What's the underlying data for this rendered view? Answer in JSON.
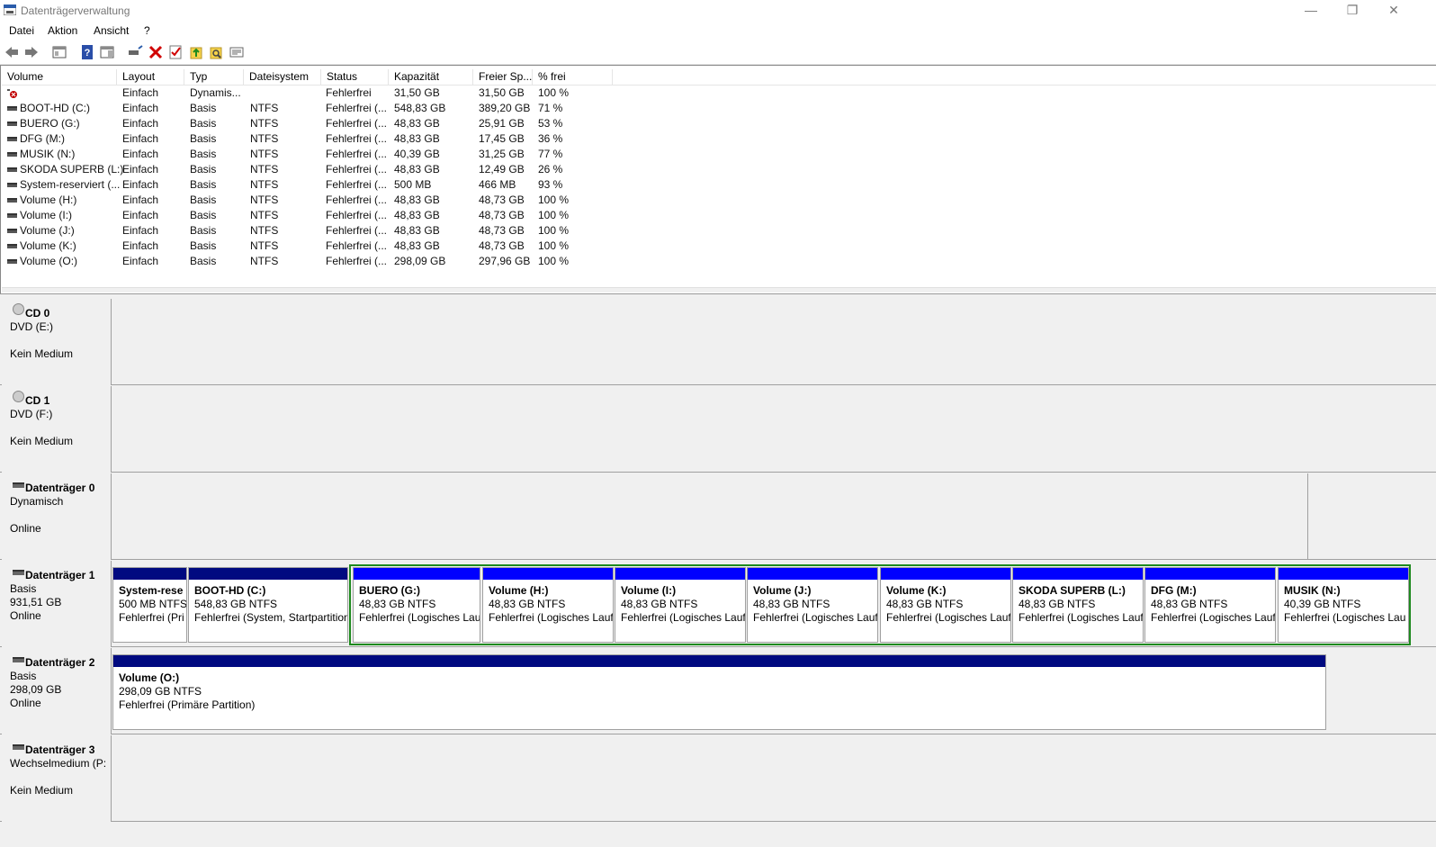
{
  "window": {
    "title": "Datenträgerverwaltung",
    "minimize": "—",
    "maximize": "❐",
    "close": "✕"
  },
  "menu": [
    "Datei",
    "Aktion",
    "Ansicht",
    "?"
  ],
  "columns": [
    "Volume",
    "Layout",
    "Typ",
    "Dateisystem",
    "Status",
    "Kapazität",
    "Freier Sp...",
    "% frei"
  ],
  "volumes": [
    {
      "icon": "error-icon",
      "name": "",
      "layout": "Einfach",
      "typ": "Dynamis...",
      "fs": "",
      "status": "Fehlerfrei",
      "cap": "31,50 GB",
      "free": "31,50 GB",
      "pct": "100 %"
    },
    {
      "icon": "drive-icon",
      "name": "BOOT-HD (C:)",
      "layout": "Einfach",
      "typ": "Basis",
      "fs": "NTFS",
      "status": "Fehlerfrei (...",
      "cap": "548,83 GB",
      "free": "389,20 GB",
      "pct": "71 %"
    },
    {
      "icon": "drive-icon",
      "name": "BUERO (G:)",
      "layout": "Einfach",
      "typ": "Basis",
      "fs": "NTFS",
      "status": "Fehlerfrei (...",
      "cap": "48,83 GB",
      "free": "25,91 GB",
      "pct": "53 %"
    },
    {
      "icon": "drive-icon",
      "name": "DFG (M:)",
      "layout": "Einfach",
      "typ": "Basis",
      "fs": "NTFS",
      "status": "Fehlerfrei (...",
      "cap": "48,83 GB",
      "free": "17,45 GB",
      "pct": "36 %"
    },
    {
      "icon": "drive-icon",
      "name": "MUSIK (N:)",
      "layout": "Einfach",
      "typ": "Basis",
      "fs": "NTFS",
      "status": "Fehlerfrei (...",
      "cap": "40,39 GB",
      "free": "31,25 GB",
      "pct": "77 %"
    },
    {
      "icon": "drive-icon",
      "name": "SKODA SUPERB (L:)",
      "layout": "Einfach",
      "typ": "Basis",
      "fs": "NTFS",
      "status": "Fehlerfrei (...",
      "cap": "48,83 GB",
      "free": "12,49 GB",
      "pct": "26 %"
    },
    {
      "icon": "drive-icon",
      "name": "System-reserviert (...",
      "layout": "Einfach",
      "typ": "Basis",
      "fs": "NTFS",
      "status": "Fehlerfrei (...",
      "cap": "500 MB",
      "free": "466 MB",
      "pct": "93 %"
    },
    {
      "icon": "drive-icon",
      "name": "Volume (H:)",
      "layout": "Einfach",
      "typ": "Basis",
      "fs": "NTFS",
      "status": "Fehlerfrei (...",
      "cap": "48,83 GB",
      "free": "48,73 GB",
      "pct": "100 %"
    },
    {
      "icon": "drive-icon",
      "name": "Volume (I:)",
      "layout": "Einfach",
      "typ": "Basis",
      "fs": "NTFS",
      "status": "Fehlerfrei (...",
      "cap": "48,83 GB",
      "free": "48,73 GB",
      "pct": "100 %"
    },
    {
      "icon": "drive-icon",
      "name": "Volume (J:)",
      "layout": "Einfach",
      "typ": "Basis",
      "fs": "NTFS",
      "status": "Fehlerfrei (...",
      "cap": "48,83 GB",
      "free": "48,73 GB",
      "pct": "100 %"
    },
    {
      "icon": "drive-icon",
      "name": "Volume (K:)",
      "layout": "Einfach",
      "typ": "Basis",
      "fs": "NTFS",
      "status": "Fehlerfrei (...",
      "cap": "48,83 GB",
      "free": "48,73 GB",
      "pct": "100 %"
    },
    {
      "icon": "drive-icon",
      "name": "Volume (O:)",
      "layout": "Einfach",
      "typ": "Basis",
      "fs": "NTFS",
      "status": "Fehlerfrei (...",
      "cap": "298,09 GB",
      "free": "297,96 GB",
      "pct": "100 %"
    }
  ],
  "disks": [
    {
      "name": "CD 0",
      "l1": "DVD (E:)",
      "l2": "",
      "l3": "Kein Medium",
      "partitions": []
    },
    {
      "name": "CD 1",
      "l1": "DVD (F:)",
      "l2": "",
      "l3": "Kein Medium",
      "partitions": []
    },
    {
      "name": "Datenträger 0",
      "l1": "Dynamisch",
      "l2": "",
      "l3": "Online",
      "partitions": []
    },
    {
      "name": "Datenträger 1",
      "l1": "Basis",
      "l2": "931,51 GB",
      "l3": "Online",
      "partitions": [
        {
          "name": "System-rese",
          "size": "500 MB NTFS",
          "status": "Fehlerfrei (Pri",
          "kind": "primary"
        },
        {
          "name": "BOOT-HD  (C:)",
          "size": "548,83 GB NTFS",
          "status": "Fehlerfrei (System, Startpartition",
          "kind": "primary"
        },
        {
          "name": "BUERO  (G:)",
          "size": "48,83 GB NTFS",
          "status": "Fehlerfrei (Logisches Lau",
          "kind": "logical"
        },
        {
          "name": "Volume  (H:)",
          "size": "48,83 GB NTFS",
          "status": "Fehlerfrei (Logisches Lauf",
          "kind": "logical"
        },
        {
          "name": "Volume  (I:)",
          "size": "48,83 GB NTFS",
          "status": "Fehlerfrei (Logisches Lauf",
          "kind": "logical"
        },
        {
          "name": "Volume  (J:)",
          "size": "48,83 GB NTFS",
          "status": "Fehlerfrei (Logisches Lauf",
          "kind": "logical"
        },
        {
          "name": "Volume  (K:)",
          "size": "48,83 GB NTFS",
          "status": "Fehlerfrei (Logisches Lauf",
          "kind": "logical"
        },
        {
          "name": "SKODA SUPERB  (L:)",
          "size": "48,83 GB NTFS",
          "status": "Fehlerfrei (Logisches Lauf",
          "kind": "logical"
        },
        {
          "name": "DFG  (M:)",
          "size": "48,83 GB NTFS",
          "status": "Fehlerfrei (Logisches Lauf",
          "kind": "logical"
        },
        {
          "name": "MUSIK  (N:)",
          "size": "40,39 GB NTFS",
          "status": "Fehlerfrei (Logisches Lau",
          "kind": "logical"
        }
      ]
    },
    {
      "name": "Datenträger 2",
      "l1": "Basis",
      "l2": "298,09 GB",
      "l3": "Online",
      "partitions": [
        {
          "name": "Volume  (O:)",
          "size": "298,09 GB NTFS",
          "status": "Fehlerfrei (Primäre Partition)",
          "kind": "primary"
        }
      ]
    },
    {
      "name": "Datenträger 3",
      "l1": "Wechselmedium (P:",
      "l2": "",
      "l3": "Kein Medium",
      "partitions": []
    }
  ],
  "colors": {
    "primary_bar": "#000a80",
    "logical_bar": "#0000ff",
    "extended_border": "#1e8a1e"
  }
}
